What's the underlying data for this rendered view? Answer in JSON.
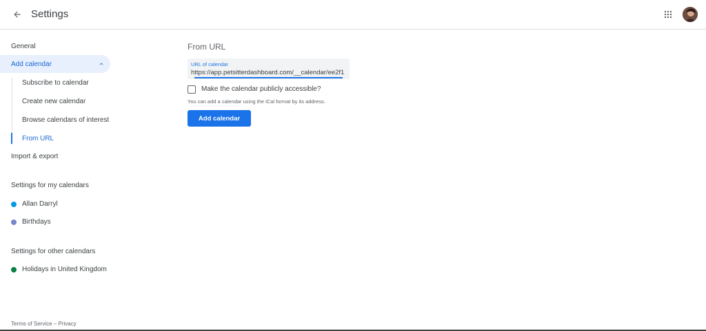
{
  "header": {
    "title": "Settings",
    "back_icon": "arrow-left-icon",
    "apps_icon": "apps-grid-icon"
  },
  "sidebar": {
    "general": "General",
    "add_calendar": "Add calendar",
    "sub_items": [
      "Subscribe to calendar",
      "Create new calendar",
      "Browse calendars of interest",
      "From URL"
    ],
    "import_export": "Import & export",
    "my_calendars_heading": "Settings for my calendars",
    "my_calendars": [
      {
        "name": "Allan Darryl",
        "color": "#039be5"
      },
      {
        "name": "Birthdays",
        "color": "#7986cb"
      }
    ],
    "other_calendars_heading": "Settings for other calendars",
    "other_calendars": [
      {
        "name": "Holidays in United Kingdom",
        "color": "#0b8043"
      }
    ]
  },
  "main": {
    "section_title": "From URL",
    "url_label": "URL of calendar",
    "url_value": "https://app.petsitterdashboard.com/__calendar/ee2f1",
    "public_checkbox_label": "Make the calendar publicly accessible?",
    "public_checked": false,
    "help_text": "You can add a calendar using the iCal format by its address.",
    "add_button": "Add calendar"
  },
  "footer": {
    "terms": "Terms of Service",
    "separator": "–",
    "privacy": "Privacy"
  },
  "colors": {
    "accent": "#1a73e8",
    "active_bg": "#e8f0fe"
  }
}
